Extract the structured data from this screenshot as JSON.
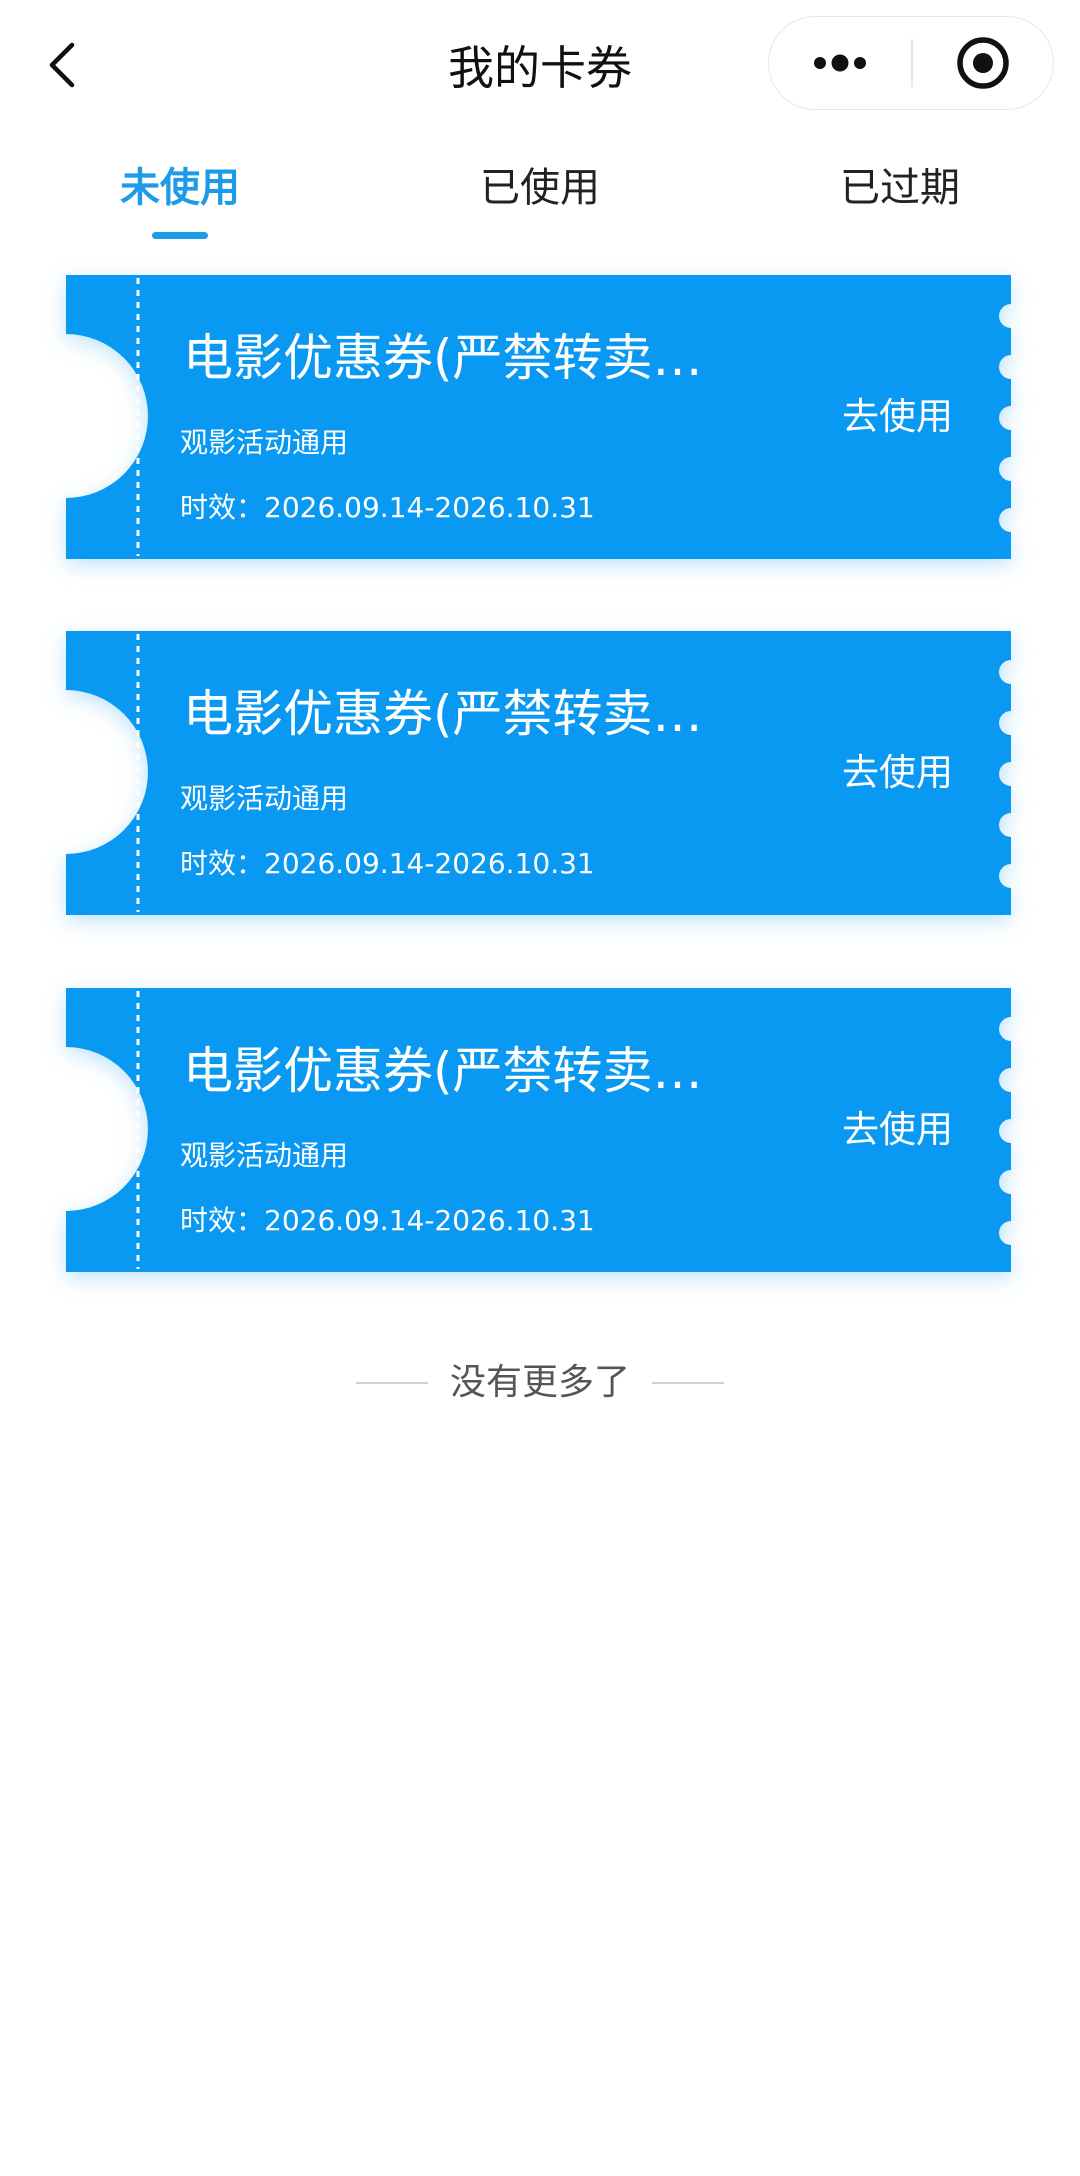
{
  "header": {
    "title": "我的卡券",
    "back_icon": "chevron-left-icon",
    "more_icon": "more-dots-icon",
    "close_icon": "target-close-icon"
  },
  "tabs": [
    {
      "label": "未使用",
      "active": true
    },
    {
      "label": "已使用",
      "active": false
    },
    {
      "label": "已过期",
      "active": false
    }
  ],
  "coupons": [
    {
      "title": "电影优惠券(严禁转卖转…",
      "description": "观影活动通用",
      "validity": "时效：2026.09.14-2026.10.31",
      "action": "去使用"
    },
    {
      "title": "电影优惠券(严禁转卖转…",
      "description": "观影活动通用",
      "validity": "时效：2026.09.14-2026.10.31",
      "action": "去使用"
    },
    {
      "title": "电影优惠券(严禁转卖转…",
      "description": "观影活动通用",
      "validity": "时效：2026.09.14-2026.10.31",
      "action": "去使用"
    }
  ],
  "list_end_text": "没有更多了",
  "colors": {
    "accent": "#1e9be8",
    "coupon_bg": "#0a99f2",
    "text_primary": "#111111"
  }
}
